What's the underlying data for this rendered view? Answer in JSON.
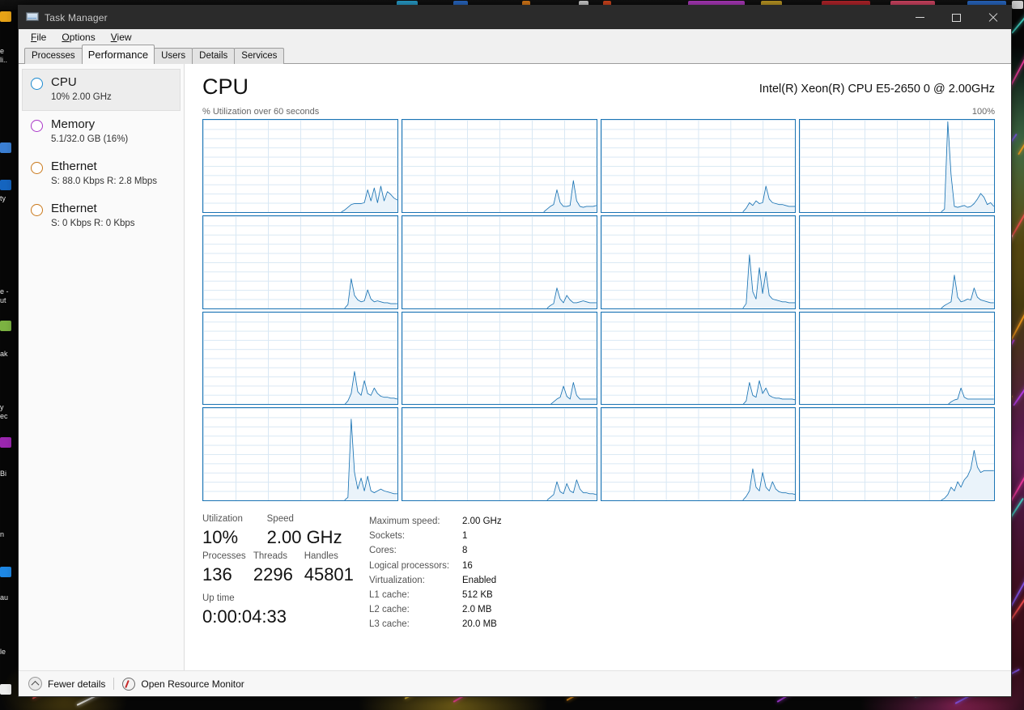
{
  "window": {
    "title": "Task Manager",
    "app_icon": "task-manager-icon",
    "controls": {
      "minimize": "minimize-icon",
      "maximize": "maximize-icon",
      "close": "close-icon"
    }
  },
  "menu": {
    "items": [
      {
        "label": "File",
        "mnemonic": "F"
      },
      {
        "label": "Options",
        "mnemonic": "O"
      },
      {
        "label": "View",
        "mnemonic": "V"
      }
    ]
  },
  "tabs": {
    "active": "Performance",
    "items": [
      {
        "label": "Processes"
      },
      {
        "label": "Performance"
      },
      {
        "label": "Users"
      },
      {
        "label": "Details"
      },
      {
        "label": "Services"
      }
    ]
  },
  "sidebar": {
    "items": [
      {
        "title": "CPU",
        "sub": "10%  2.00 GHz",
        "color": "#1b8ad0",
        "selected": true
      },
      {
        "title": "Memory",
        "sub": "5.1/32.0 GB (16%)",
        "color": "#a936c7",
        "selected": false
      },
      {
        "title": "Ethernet",
        "sub": "S: 88.0 Kbps R: 2.8 Mbps",
        "color": "#c9781a",
        "selected": false
      },
      {
        "title": "Ethernet",
        "sub": "S: 0 Kbps R: 0 Kbps",
        "color": "#c9781a",
        "selected": false
      }
    ]
  },
  "main": {
    "heading": "CPU",
    "model": "Intel(R) Xeon(R) CPU E5-2650 0 @ 2.00GHz",
    "graph_axis_label": "% Utilization over 60 seconds",
    "graph_max_label": "100%"
  },
  "stats": {
    "left": {
      "utilization_label": "Utilization",
      "utilization_value": "10%",
      "speed_label": "Speed",
      "speed_value": "2.00 GHz",
      "processes_label": "Processes",
      "processes_value": "136",
      "threads_label": "Threads",
      "threads_value": "2296",
      "handles_label": "Handles",
      "handles_value": "45801",
      "uptime_label": "Up time",
      "uptime_value": "0:00:04:33"
    },
    "right": [
      {
        "key": "Maximum speed:",
        "value": "2.00 GHz"
      },
      {
        "key": "Sockets:",
        "value": "1"
      },
      {
        "key": "Cores:",
        "value": "8"
      },
      {
        "key": "Logical processors:",
        "value": "16"
      },
      {
        "key": "Virtualization:",
        "value": "Enabled"
      },
      {
        "key": "L1 cache:",
        "value": "512 KB"
      },
      {
        "key": "L2 cache:",
        "value": "2.0 MB"
      },
      {
        "key": "L3 cache:",
        "value": "20.0 MB"
      }
    ]
  },
  "statusbar": {
    "fewer_details": "Fewer details",
    "fewer_details_icon": "chevron-up-icon",
    "open_resource_monitor": "Open Resource Monitor",
    "resource_monitor_icon": "resource-monitor-icon"
  },
  "colors": {
    "graph_line": "#1b74b4",
    "graph_fill": "#eaf3fa",
    "graph_border": "#1b74b4",
    "graph_grid": "#d9e8f4",
    "titlebar": "#2b2b2b",
    "selection": "#ededed"
  },
  "chart_data": {
    "type": "line",
    "title": "% Utilization over 60 seconds",
    "ylabel": "% Utilization",
    "xlabel": "60 seconds",
    "ylim": [
      0,
      100
    ],
    "xlim": [
      0,
      60
    ],
    "grid": true,
    "legend": "none",
    "note": "16 logical processor graphs, each plotting % utilization over the last 60 seconds. x is seconds-ago index 0..59 (left = oldest).",
    "series": [
      {
        "name": "CPU 0",
        "values": [
          0,
          0,
          0,
          0,
          0,
          0,
          0,
          0,
          0,
          0,
          0,
          0,
          0,
          0,
          0,
          0,
          0,
          0,
          0,
          0,
          0,
          0,
          0,
          0,
          0,
          0,
          0,
          0,
          0,
          0,
          0,
          0,
          0,
          0,
          0,
          0,
          0,
          0,
          0,
          0,
          0,
          0,
          0,
          2,
          5,
          8,
          9,
          9,
          9,
          10,
          24,
          12,
          26,
          10,
          28,
          12,
          22,
          19,
          15,
          13
        ]
      },
      {
        "name": "CPU 1",
        "values": [
          0,
          0,
          0,
          0,
          0,
          0,
          0,
          0,
          0,
          0,
          0,
          0,
          0,
          0,
          0,
          0,
          0,
          0,
          0,
          0,
          0,
          0,
          0,
          0,
          0,
          0,
          0,
          0,
          0,
          0,
          0,
          0,
          0,
          0,
          0,
          0,
          0,
          0,
          0,
          0,
          0,
          0,
          0,
          0,
          3,
          6,
          8,
          24,
          10,
          6,
          6,
          7,
          34,
          12,
          6,
          5,
          6,
          6,
          6,
          7
        ]
      },
      {
        "name": "CPU 2",
        "values": [
          0,
          0,
          0,
          0,
          0,
          0,
          0,
          0,
          0,
          0,
          0,
          0,
          0,
          0,
          0,
          0,
          0,
          0,
          0,
          0,
          0,
          0,
          0,
          0,
          0,
          0,
          0,
          0,
          0,
          0,
          0,
          0,
          0,
          0,
          0,
          0,
          0,
          0,
          0,
          0,
          0,
          0,
          0,
          0,
          4,
          10,
          7,
          12,
          9,
          10,
          28,
          14,
          10,
          9,
          8,
          8,
          7,
          6,
          6,
          6
        ]
      },
      {
        "name": "CPU 3",
        "values": [
          0,
          0,
          0,
          0,
          0,
          0,
          0,
          0,
          0,
          0,
          0,
          0,
          0,
          0,
          0,
          0,
          0,
          0,
          0,
          0,
          0,
          0,
          0,
          0,
          0,
          0,
          0,
          0,
          0,
          0,
          0,
          0,
          0,
          0,
          0,
          0,
          0,
          0,
          0,
          0,
          0,
          0,
          0,
          0,
          3,
          98,
          40,
          6,
          5,
          6,
          7,
          5,
          6,
          9,
          14,
          20,
          16,
          8,
          10,
          6
        ]
      },
      {
        "name": "CPU 4",
        "values": [
          0,
          0,
          0,
          0,
          0,
          0,
          0,
          0,
          0,
          0,
          0,
          0,
          0,
          0,
          0,
          0,
          0,
          0,
          0,
          0,
          0,
          0,
          0,
          0,
          0,
          0,
          0,
          0,
          0,
          0,
          0,
          0,
          0,
          0,
          0,
          0,
          0,
          0,
          0,
          0,
          0,
          0,
          0,
          0,
          4,
          32,
          14,
          9,
          7,
          8,
          20,
          10,
          7,
          8,
          7,
          6,
          6,
          5,
          5,
          5
        ]
      },
      {
        "name": "CPU 5",
        "values": [
          0,
          0,
          0,
          0,
          0,
          0,
          0,
          0,
          0,
          0,
          0,
          0,
          0,
          0,
          0,
          0,
          0,
          0,
          0,
          0,
          0,
          0,
          0,
          0,
          0,
          0,
          0,
          0,
          0,
          0,
          0,
          0,
          0,
          0,
          0,
          0,
          0,
          0,
          0,
          0,
          0,
          0,
          0,
          0,
          0,
          3,
          5,
          22,
          10,
          6,
          14,
          9,
          6,
          6,
          7,
          8,
          7,
          6,
          6,
          6
        ]
      },
      {
        "name": "CPU 6",
        "values": [
          0,
          0,
          0,
          0,
          0,
          0,
          0,
          0,
          0,
          0,
          0,
          0,
          0,
          0,
          0,
          0,
          0,
          0,
          0,
          0,
          0,
          0,
          0,
          0,
          0,
          0,
          0,
          0,
          0,
          0,
          0,
          0,
          0,
          0,
          0,
          0,
          0,
          0,
          0,
          0,
          0,
          0,
          0,
          0,
          5,
          58,
          18,
          10,
          44,
          16,
          40,
          14,
          10,
          9,
          8,
          7,
          7,
          6,
          6,
          6
        ]
      },
      {
        "name": "CPU 7",
        "values": [
          0,
          0,
          0,
          0,
          0,
          0,
          0,
          0,
          0,
          0,
          0,
          0,
          0,
          0,
          0,
          0,
          0,
          0,
          0,
          0,
          0,
          0,
          0,
          0,
          0,
          0,
          0,
          0,
          0,
          0,
          0,
          0,
          0,
          0,
          0,
          0,
          0,
          0,
          0,
          0,
          0,
          0,
          0,
          0,
          3,
          5,
          7,
          36,
          12,
          7,
          8,
          10,
          9,
          22,
          12,
          9,
          8,
          7,
          6,
          6
        ]
      },
      {
        "name": "CPU 8",
        "values": [
          0,
          0,
          0,
          0,
          0,
          0,
          0,
          0,
          0,
          0,
          0,
          0,
          0,
          0,
          0,
          0,
          0,
          0,
          0,
          0,
          0,
          0,
          0,
          0,
          0,
          0,
          0,
          0,
          0,
          0,
          0,
          0,
          0,
          0,
          0,
          0,
          0,
          0,
          0,
          0,
          0,
          0,
          0,
          0,
          4,
          12,
          36,
          14,
          10,
          26,
          12,
          10,
          18,
          12,
          9,
          8,
          8,
          7,
          7,
          6
        ]
      },
      {
        "name": "CPU 9",
        "values": [
          0,
          0,
          0,
          0,
          0,
          0,
          0,
          0,
          0,
          0,
          0,
          0,
          0,
          0,
          0,
          0,
          0,
          0,
          0,
          0,
          0,
          0,
          0,
          0,
          0,
          0,
          0,
          0,
          0,
          0,
          0,
          0,
          0,
          0,
          0,
          0,
          0,
          0,
          0,
          0,
          0,
          0,
          0,
          0,
          0,
          0,
          3,
          6,
          8,
          20,
          9,
          6,
          24,
          10,
          6,
          6,
          6,
          6,
          6,
          6
        ]
      },
      {
        "name": "CPU 10",
        "values": [
          0,
          0,
          0,
          0,
          0,
          0,
          0,
          0,
          0,
          0,
          0,
          0,
          0,
          0,
          0,
          0,
          0,
          0,
          0,
          0,
          0,
          0,
          0,
          0,
          0,
          0,
          0,
          0,
          0,
          0,
          0,
          0,
          0,
          0,
          0,
          0,
          0,
          0,
          0,
          0,
          0,
          0,
          0,
          0,
          4,
          24,
          10,
          8,
          26,
          12,
          18,
          10,
          8,
          7,
          7,
          6,
          6,
          6,
          6,
          5
        ]
      },
      {
        "name": "CPU 11",
        "values": [
          0,
          0,
          0,
          0,
          0,
          0,
          0,
          0,
          0,
          0,
          0,
          0,
          0,
          0,
          0,
          0,
          0,
          0,
          0,
          0,
          0,
          0,
          0,
          0,
          0,
          0,
          0,
          0,
          0,
          0,
          0,
          0,
          0,
          0,
          0,
          0,
          0,
          0,
          0,
          0,
          0,
          0,
          0,
          0,
          0,
          0,
          3,
          5,
          6,
          18,
          8,
          6,
          6,
          6,
          6,
          6,
          6,
          6,
          6,
          6
        ]
      },
      {
        "name": "CPU 12",
        "values": [
          0,
          0,
          0,
          0,
          0,
          0,
          0,
          0,
          0,
          0,
          0,
          0,
          0,
          0,
          0,
          0,
          0,
          0,
          0,
          0,
          0,
          0,
          0,
          0,
          0,
          0,
          0,
          0,
          0,
          0,
          0,
          0,
          0,
          0,
          0,
          0,
          0,
          0,
          0,
          0,
          0,
          0,
          0,
          0,
          3,
          88,
          30,
          12,
          24,
          10,
          26,
          10,
          8,
          10,
          12,
          10,
          9,
          8,
          7,
          7
        ]
      },
      {
        "name": "CPU 13",
        "values": [
          0,
          0,
          0,
          0,
          0,
          0,
          0,
          0,
          0,
          0,
          0,
          0,
          0,
          0,
          0,
          0,
          0,
          0,
          0,
          0,
          0,
          0,
          0,
          0,
          0,
          0,
          0,
          0,
          0,
          0,
          0,
          0,
          0,
          0,
          0,
          0,
          0,
          0,
          0,
          0,
          0,
          0,
          0,
          0,
          0,
          3,
          6,
          20,
          9,
          7,
          18,
          10,
          8,
          22,
          12,
          8,
          8,
          7,
          7,
          6
        ]
      },
      {
        "name": "CPU 14",
        "values": [
          0,
          0,
          0,
          0,
          0,
          0,
          0,
          0,
          0,
          0,
          0,
          0,
          0,
          0,
          0,
          0,
          0,
          0,
          0,
          0,
          0,
          0,
          0,
          0,
          0,
          0,
          0,
          0,
          0,
          0,
          0,
          0,
          0,
          0,
          0,
          0,
          0,
          0,
          0,
          0,
          0,
          0,
          0,
          0,
          4,
          10,
          34,
          14,
          10,
          30,
          14,
          10,
          20,
          12,
          9,
          8,
          8,
          7,
          7,
          6
        ]
      },
      {
        "name": "CPU 15",
        "values": [
          0,
          0,
          0,
          0,
          0,
          0,
          0,
          0,
          0,
          0,
          0,
          0,
          0,
          0,
          0,
          0,
          0,
          0,
          0,
          0,
          0,
          0,
          0,
          0,
          0,
          0,
          0,
          0,
          0,
          0,
          0,
          0,
          0,
          0,
          0,
          0,
          0,
          0,
          0,
          0,
          0,
          0,
          0,
          0,
          2,
          6,
          14,
          10,
          20,
          14,
          22,
          26,
          34,
          54,
          36,
          30,
          32,
          32,
          32,
          32
        ]
      }
    ]
  }
}
